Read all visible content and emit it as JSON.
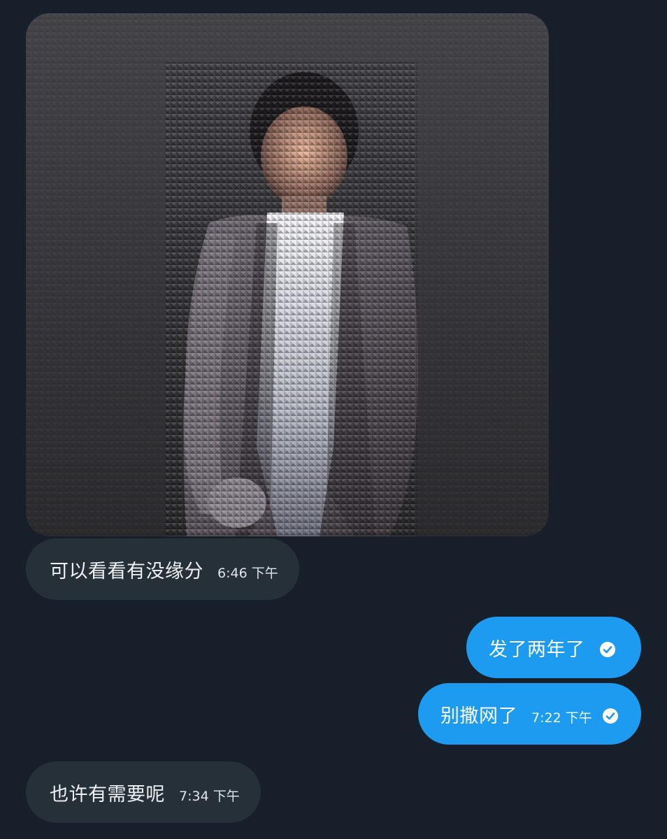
{
  "messages": [
    {
      "id": "m1",
      "direction": "incoming",
      "text": "可以看看有没缘分",
      "time": "6:46 下午"
    },
    {
      "id": "m2",
      "direction": "outgoing",
      "text": "发了两年了",
      "time": "",
      "status_icon": "check-circle-icon"
    },
    {
      "id": "m3",
      "direction": "outgoing",
      "text": "别撒网了",
      "time": "7:22 下午",
      "status_icon": "check-circle-icon"
    },
    {
      "id": "m4",
      "direction": "incoming",
      "text": "也许有需要呢",
      "time": "7:34 下午"
    }
  ],
  "photo": {
    "subject": "frosted-glass-obscured-portrait"
  },
  "colors": {
    "background": "#17202a",
    "incoming_bubble": "#263039",
    "outgoing_bubble": "#1d9bf0",
    "text": "#eef2f5"
  }
}
